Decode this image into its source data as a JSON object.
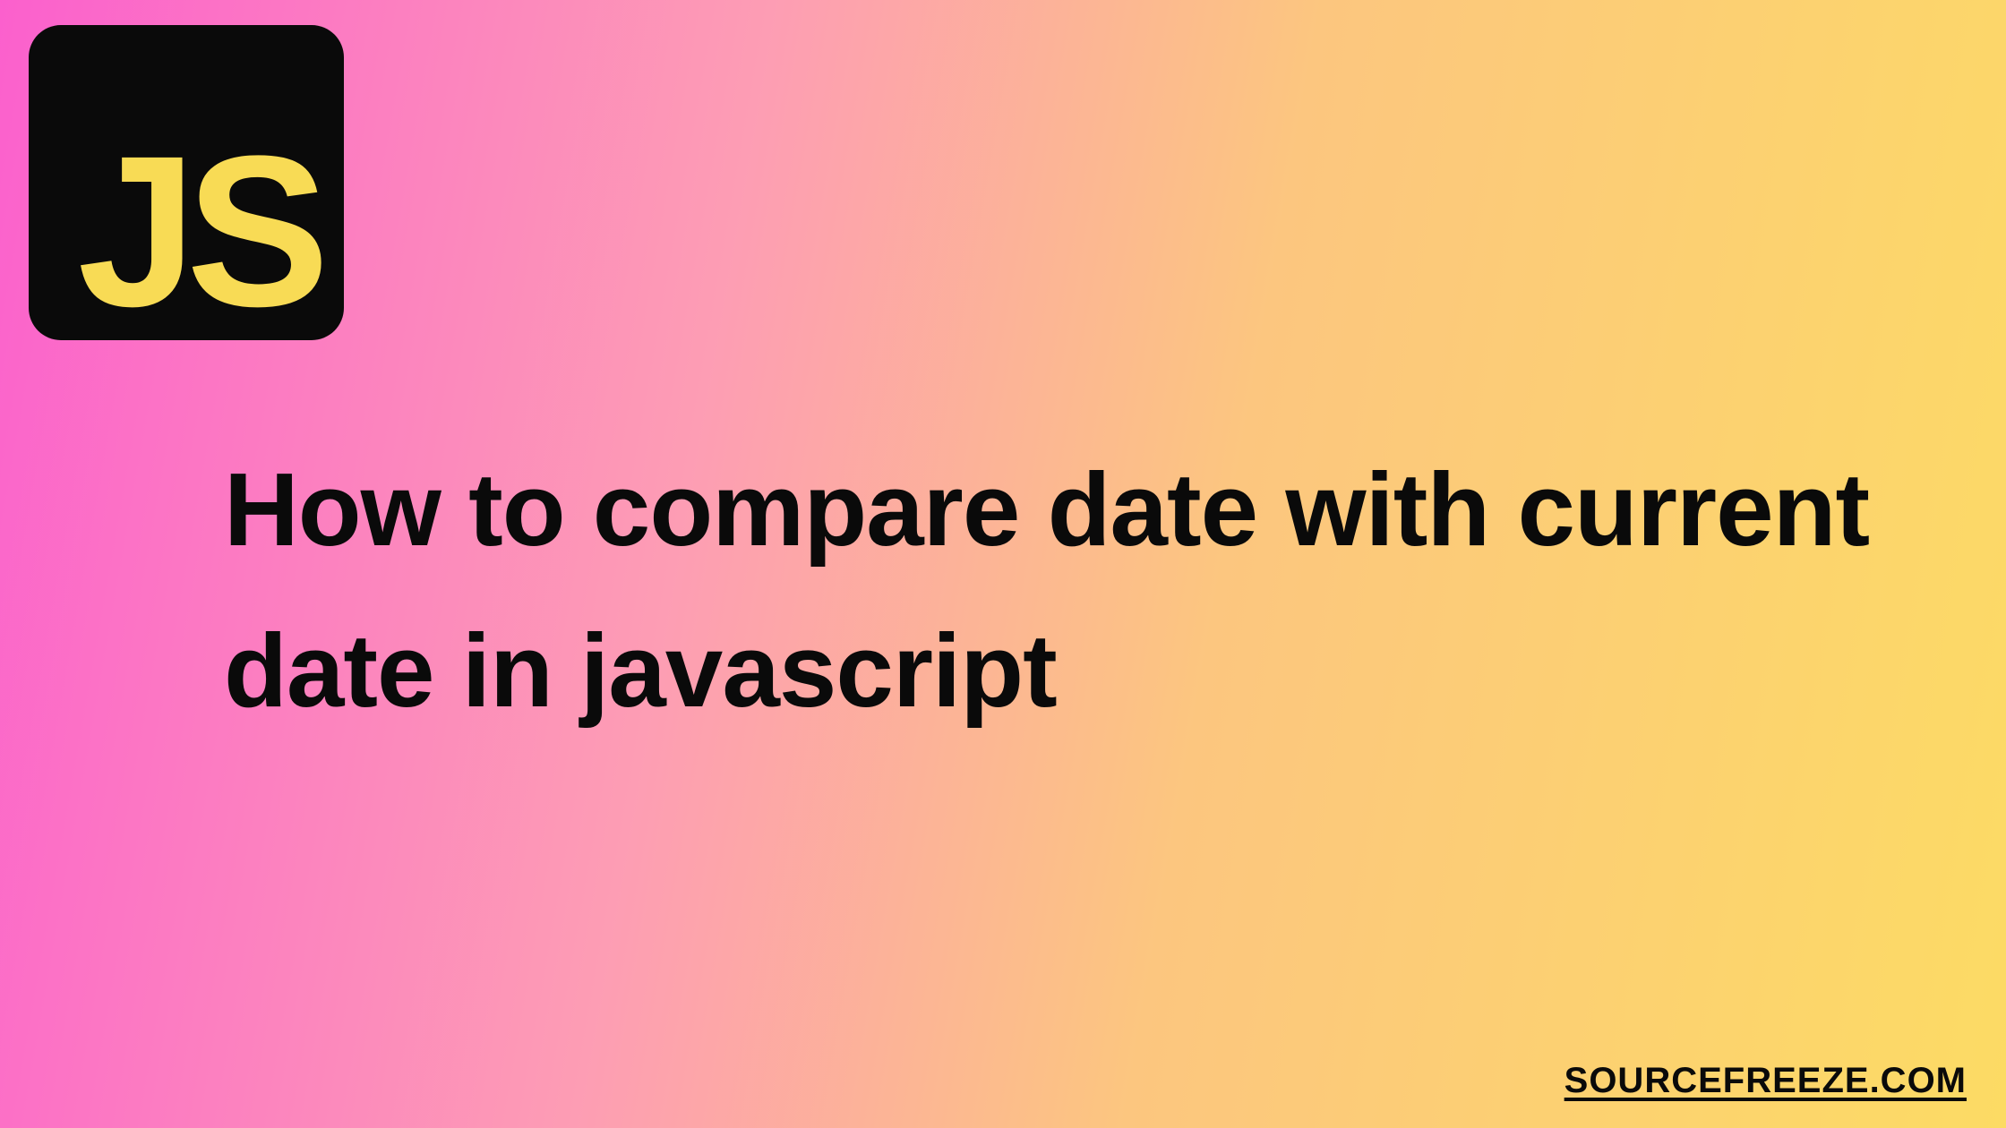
{
  "logo": {
    "text": "JS",
    "name": "javascript-logo"
  },
  "headline": "How to compare date with current date in javascript",
  "watermark": "SOURCEFREEZE.COM"
}
